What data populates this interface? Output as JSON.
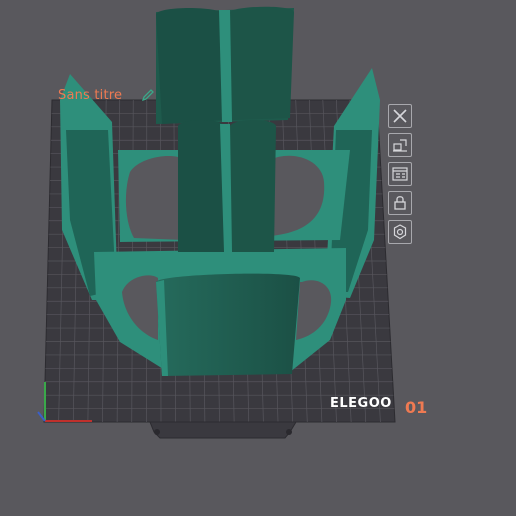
{
  "plate": {
    "title": "Sans titre",
    "number": "01",
    "brand": "ELEGOO"
  },
  "tools": [
    {
      "name": "close-plate-icon"
    },
    {
      "name": "auto-arrange-icon"
    },
    {
      "name": "plate-settings-icon"
    },
    {
      "name": "lock-icon"
    },
    {
      "name": "gear-icon"
    }
  ],
  "colors": {
    "background": "#59585d",
    "build_plate": "#3a393f",
    "grid_lines": "#55545b",
    "model_face": "#2e8f7b",
    "model_shadow": "#1e5a4c",
    "accent": "#ef7a52"
  }
}
